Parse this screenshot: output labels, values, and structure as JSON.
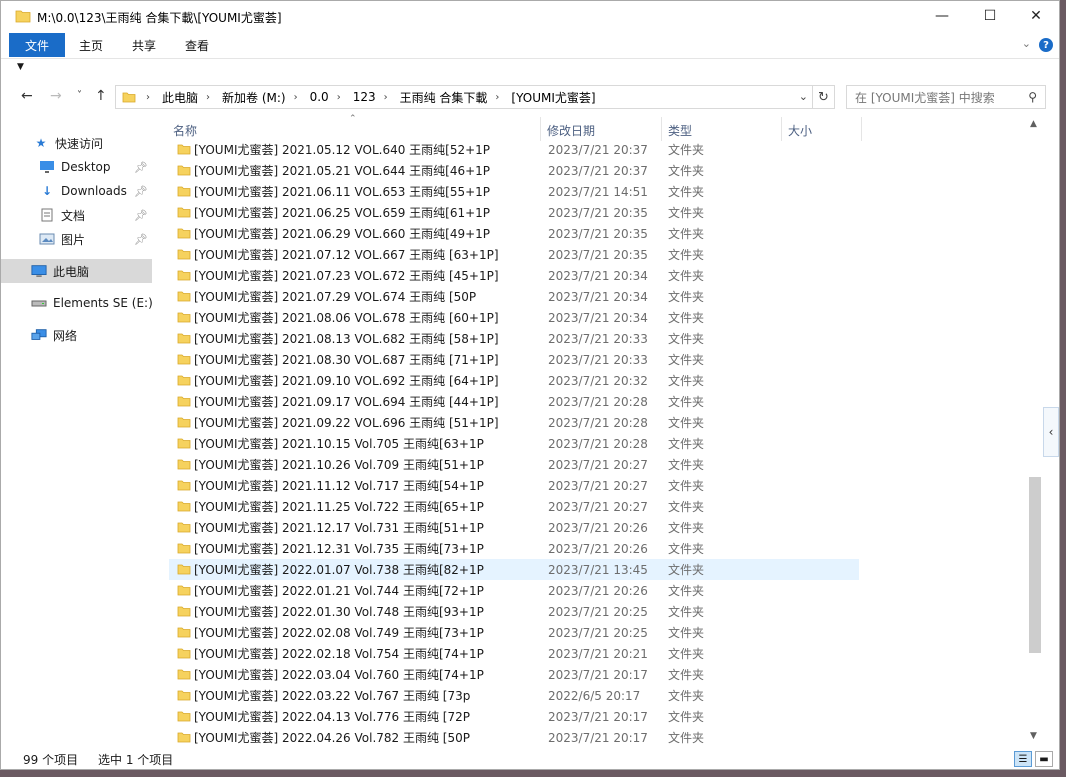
{
  "window": {
    "title": "M:\\0.0\\123\\王雨纯 合集下載\\[YOUMI尤蜜荟]",
    "minimize": "—",
    "maximize": "☐",
    "close": "✕"
  },
  "ribbon": {
    "tabs": [
      "文件",
      "主页",
      "共享",
      "查看"
    ],
    "help": "?"
  },
  "nav": {
    "back": "←",
    "forward": "→",
    "recent": "˅",
    "up": "↑",
    "breadcrumbs": [
      "此电脑",
      "新加卷 (M:)",
      "0.0",
      "123",
      "王雨纯 合集下載",
      "[YOUMI尤蜜荟]"
    ],
    "search_placeholder": "在 [YOUMI尤蜜荟] 中搜索"
  },
  "sidebar": {
    "items": [
      {
        "label": "快速访问",
        "icon": "star-icon",
        "pinned": false
      },
      {
        "label": "Desktop",
        "icon": "desktop-icon",
        "pinned": true
      },
      {
        "label": "Downloads",
        "icon": "download-icon",
        "pinned": true
      },
      {
        "label": "文档",
        "icon": "document-icon",
        "pinned": true
      },
      {
        "label": "图片",
        "icon": "pictures-icon",
        "pinned": true
      },
      {
        "label": "此电脑",
        "icon": "computer-icon",
        "pinned": false,
        "selected": true
      },
      {
        "label": "Elements SE (E:)",
        "icon": "drive-icon",
        "pinned": false
      },
      {
        "label": "网络",
        "icon": "network-icon",
        "pinned": false
      }
    ]
  },
  "columns": {
    "name": "名称",
    "date": "修改日期",
    "type": "类型",
    "size": "大小"
  },
  "files": [
    {
      "name": "[YOUMI尤蜜荟] 2021.05.12 VOL.640 王雨纯[52+1P",
      "date": "2023/7/21 20:37",
      "type": "文件夹"
    },
    {
      "name": "[YOUMI尤蜜荟] 2021.05.21 VOL.644 王雨纯[46+1P",
      "date": "2023/7/21 20:37",
      "type": "文件夹"
    },
    {
      "name": "[YOUMI尤蜜荟] 2021.06.11 VOL.653 王雨纯[55+1P",
      "date": "2023/7/21 14:51",
      "type": "文件夹"
    },
    {
      "name": "[YOUMI尤蜜荟] 2021.06.25 VOL.659 王雨纯[61+1P",
      "date": "2023/7/21 20:35",
      "type": "文件夹"
    },
    {
      "name": "[YOUMI尤蜜荟] 2021.06.29 VOL.660 王雨纯[49+1P",
      "date": "2023/7/21 20:35",
      "type": "文件夹"
    },
    {
      "name": "[YOUMI尤蜜荟] 2021.07.12 VOL.667 王雨纯 [63+1P]",
      "date": "2023/7/21 20:35",
      "type": "文件夹"
    },
    {
      "name": "[YOUMI尤蜜荟] 2021.07.23 VOL.672 王雨纯 [45+1P]",
      "date": "2023/7/21 20:34",
      "type": "文件夹"
    },
    {
      "name": "[YOUMI尤蜜荟] 2021.07.29 VOL.674 王雨纯 [50P",
      "date": "2023/7/21 20:34",
      "type": "文件夹"
    },
    {
      "name": "[YOUMI尤蜜荟] 2021.08.06 VOL.678 王雨纯 [60+1P]",
      "date": "2023/7/21 20:34",
      "type": "文件夹"
    },
    {
      "name": "[YOUMI尤蜜荟] 2021.08.13 VOL.682 王雨纯 [58+1P]",
      "date": "2023/7/21 20:33",
      "type": "文件夹"
    },
    {
      "name": "[YOUMI尤蜜荟] 2021.08.30 VOL.687 王雨纯 [71+1P]",
      "date": "2023/7/21 20:33",
      "type": "文件夹"
    },
    {
      "name": "[YOUMI尤蜜荟] 2021.09.10 VOL.692 王雨纯 [64+1P]",
      "date": "2023/7/21 20:32",
      "type": "文件夹"
    },
    {
      "name": "[YOUMI尤蜜荟] 2021.09.17 VOL.694 王雨纯 [44+1P]",
      "date": "2023/7/21 20:28",
      "type": "文件夹"
    },
    {
      "name": "[YOUMI尤蜜荟] 2021.09.22 VOL.696 王雨纯 [51+1P]",
      "date": "2023/7/21 20:28",
      "type": "文件夹"
    },
    {
      "name": "[YOUMI尤蜜荟] 2021.10.15 Vol.705 王雨纯[63+1P",
      "date": "2023/7/21 20:28",
      "type": "文件夹"
    },
    {
      "name": "[YOUMI尤蜜荟] 2021.10.26 Vol.709 王雨纯[51+1P",
      "date": "2023/7/21 20:27",
      "type": "文件夹"
    },
    {
      "name": "[YOUMI尤蜜荟] 2021.11.12 Vol.717 王雨纯[54+1P",
      "date": "2023/7/21 20:27",
      "type": "文件夹"
    },
    {
      "name": "[YOUMI尤蜜荟] 2021.11.25 Vol.722 王雨纯[65+1P",
      "date": "2023/7/21 20:27",
      "type": "文件夹"
    },
    {
      "name": "[YOUMI尤蜜荟] 2021.12.17 Vol.731 王雨纯[51+1P",
      "date": "2023/7/21 20:26",
      "type": "文件夹"
    },
    {
      "name": "[YOUMI尤蜜荟] 2021.12.31 Vol.735 王雨纯[73+1P",
      "date": "2023/7/21 20:26",
      "type": "文件夹"
    },
    {
      "name": "[YOUMI尤蜜荟] 2022.01.07 Vol.738 王雨纯[82+1P",
      "date": "2023/7/21 13:45",
      "type": "文件夹",
      "selected": true
    },
    {
      "name": "[YOUMI尤蜜荟] 2022.01.21 Vol.744 王雨纯[72+1P",
      "date": "2023/7/21 20:26",
      "type": "文件夹"
    },
    {
      "name": "[YOUMI尤蜜荟] 2022.01.30 Vol.748 王雨纯[93+1P",
      "date": "2023/7/21 20:25",
      "type": "文件夹"
    },
    {
      "name": "[YOUMI尤蜜荟] 2022.02.08 Vol.749 王雨纯[73+1P",
      "date": "2023/7/21 20:25",
      "type": "文件夹"
    },
    {
      "name": "[YOUMI尤蜜荟] 2022.02.18 Vol.754 王雨纯[74+1P",
      "date": "2023/7/21 20:21",
      "type": "文件夹"
    },
    {
      "name": "[YOUMI尤蜜荟] 2022.03.04 Vol.760 王雨纯[74+1P",
      "date": "2023/7/21 20:17",
      "type": "文件夹"
    },
    {
      "name": "[YOUMI尤蜜荟] 2022.03.22 Vol.767 王雨纯 [73p",
      "date": "2022/6/5 20:17",
      "type": "文件夹"
    },
    {
      "name": "[YOUMI尤蜜荟] 2022.04.13 Vol.776 王雨纯 [72P",
      "date": "2023/7/21 20:17",
      "type": "文件夹"
    },
    {
      "name": "[YOUMI尤蜜荟] 2022.04.26 Vol.782 王雨纯 [50P",
      "date": "2023/7/21 20:17",
      "type": "文件夹"
    }
  ],
  "status": {
    "count": "99 个项目",
    "selected": "选中 1 个项目"
  },
  "colors": {
    "accent": "#1a6cc8",
    "folder": "#f6d25e",
    "selected_row": "#e5f3ff"
  }
}
